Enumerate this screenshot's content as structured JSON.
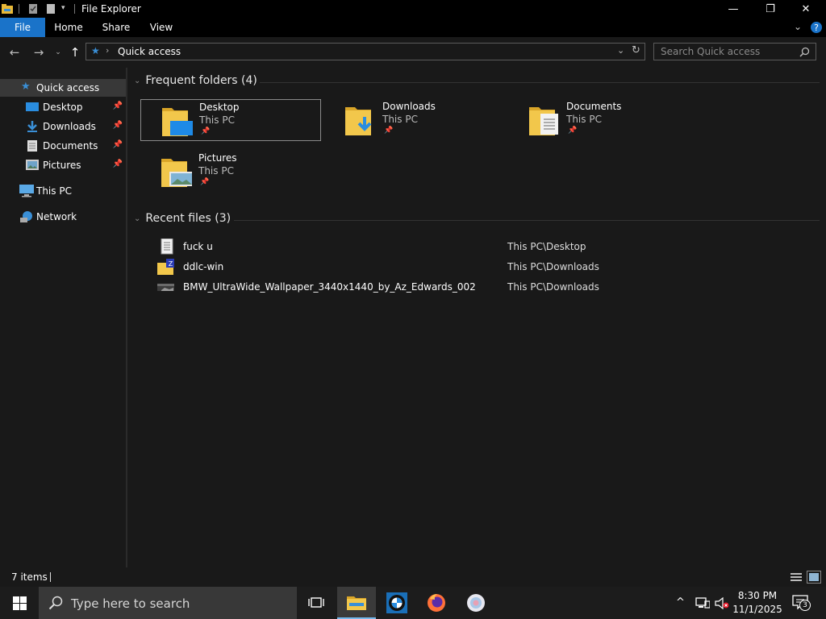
{
  "window": {
    "title": "File Explorer",
    "controls": {
      "minimize": "—",
      "maximize": "❐",
      "close": "✕"
    }
  },
  "ribbon": {
    "tabs": [
      "File",
      "Home",
      "Share",
      "View"
    ],
    "accent": "#1a73c9"
  },
  "address": {
    "path": "Quick access",
    "search_placeholder": "Search Quick access"
  },
  "nav": {
    "items": [
      {
        "label": "Quick access",
        "icon": "star-icon",
        "selected": true
      },
      {
        "label": "Desktop",
        "icon": "desktop-icon",
        "pinned": true
      },
      {
        "label": "Downloads",
        "icon": "download-icon",
        "pinned": true
      },
      {
        "label": "Documents",
        "icon": "documents-icon",
        "pinned": true
      },
      {
        "label": "Pictures",
        "icon": "pictures-icon",
        "pinned": true
      },
      {
        "label": "This PC",
        "icon": "computer-icon"
      },
      {
        "label": "Network",
        "icon": "network-icon"
      }
    ]
  },
  "frequent": {
    "header": "Frequent folders (4)",
    "folders": [
      {
        "name": "Desktop",
        "location": "This PC",
        "selected": true
      },
      {
        "name": "Downloads",
        "location": "This PC"
      },
      {
        "name": "Documents",
        "location": "This PC"
      },
      {
        "name": "Pictures",
        "location": "This PC"
      }
    ]
  },
  "recent": {
    "header": "Recent files (3)",
    "files": [
      {
        "name": "fuck u",
        "path": "This PC\\Desktop",
        "icon": "text-file-icon"
      },
      {
        "name": "ddlc-win",
        "path": "This PC\\Downloads",
        "icon": "zip-folder-icon"
      },
      {
        "name": "BMW_UltraWide_Wallpaper_3440x1440_by_Az_Edwards_002",
        "path": "This PC\\Downloads",
        "icon": "image-file-icon"
      }
    ]
  },
  "status": {
    "count": "7 items"
  },
  "taskbar": {
    "search_text": "Type here to search",
    "time": "8:30 PM",
    "date": "11/1/2025",
    "notifications": "3"
  }
}
